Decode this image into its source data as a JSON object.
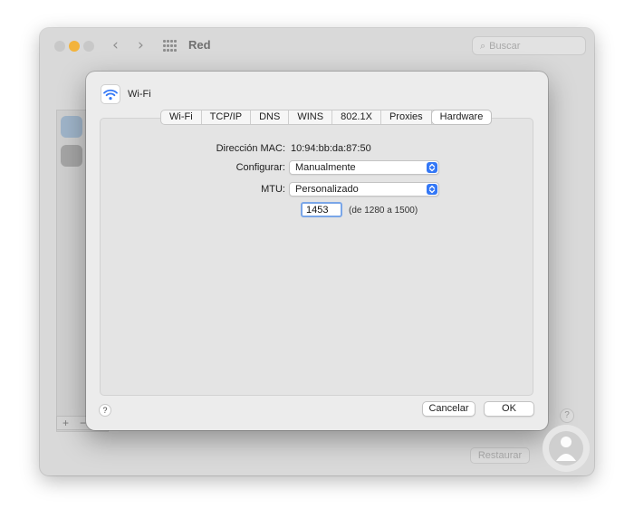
{
  "background_window": {
    "title": "Red",
    "search_placeholder": "Buscar",
    "restore_label": "Restaurar",
    "help_label": "?",
    "plus_label": "+",
    "minus_label": "−"
  },
  "sheet": {
    "title": "Wi-Fi",
    "tabs": [
      {
        "label": "Wi-Fi",
        "active": false
      },
      {
        "label": "TCP/IP",
        "active": false
      },
      {
        "label": "DNS",
        "active": false
      },
      {
        "label": "WINS",
        "active": false
      },
      {
        "label": "802.1X",
        "active": false
      },
      {
        "label": "Proxies",
        "active": false
      },
      {
        "label": "Hardware",
        "active": true
      }
    ],
    "mac_label": "Dirección MAC:",
    "mac_value": "10:94:bb:da:87:50",
    "configure_label": "Configurar:",
    "configure_value": "Manualmente",
    "mtu_label": "MTU:",
    "mtu_value": "Personalizado",
    "mtu_number": "1453",
    "mtu_range": "(de 1280 a 1500)",
    "help_label": "?",
    "cancel_label": "Cancelar",
    "ok_label": "OK"
  },
  "colors": {
    "accent": "#3478f6",
    "sheet_bg": "#ececec",
    "window_bg": "#d9d9d9"
  }
}
